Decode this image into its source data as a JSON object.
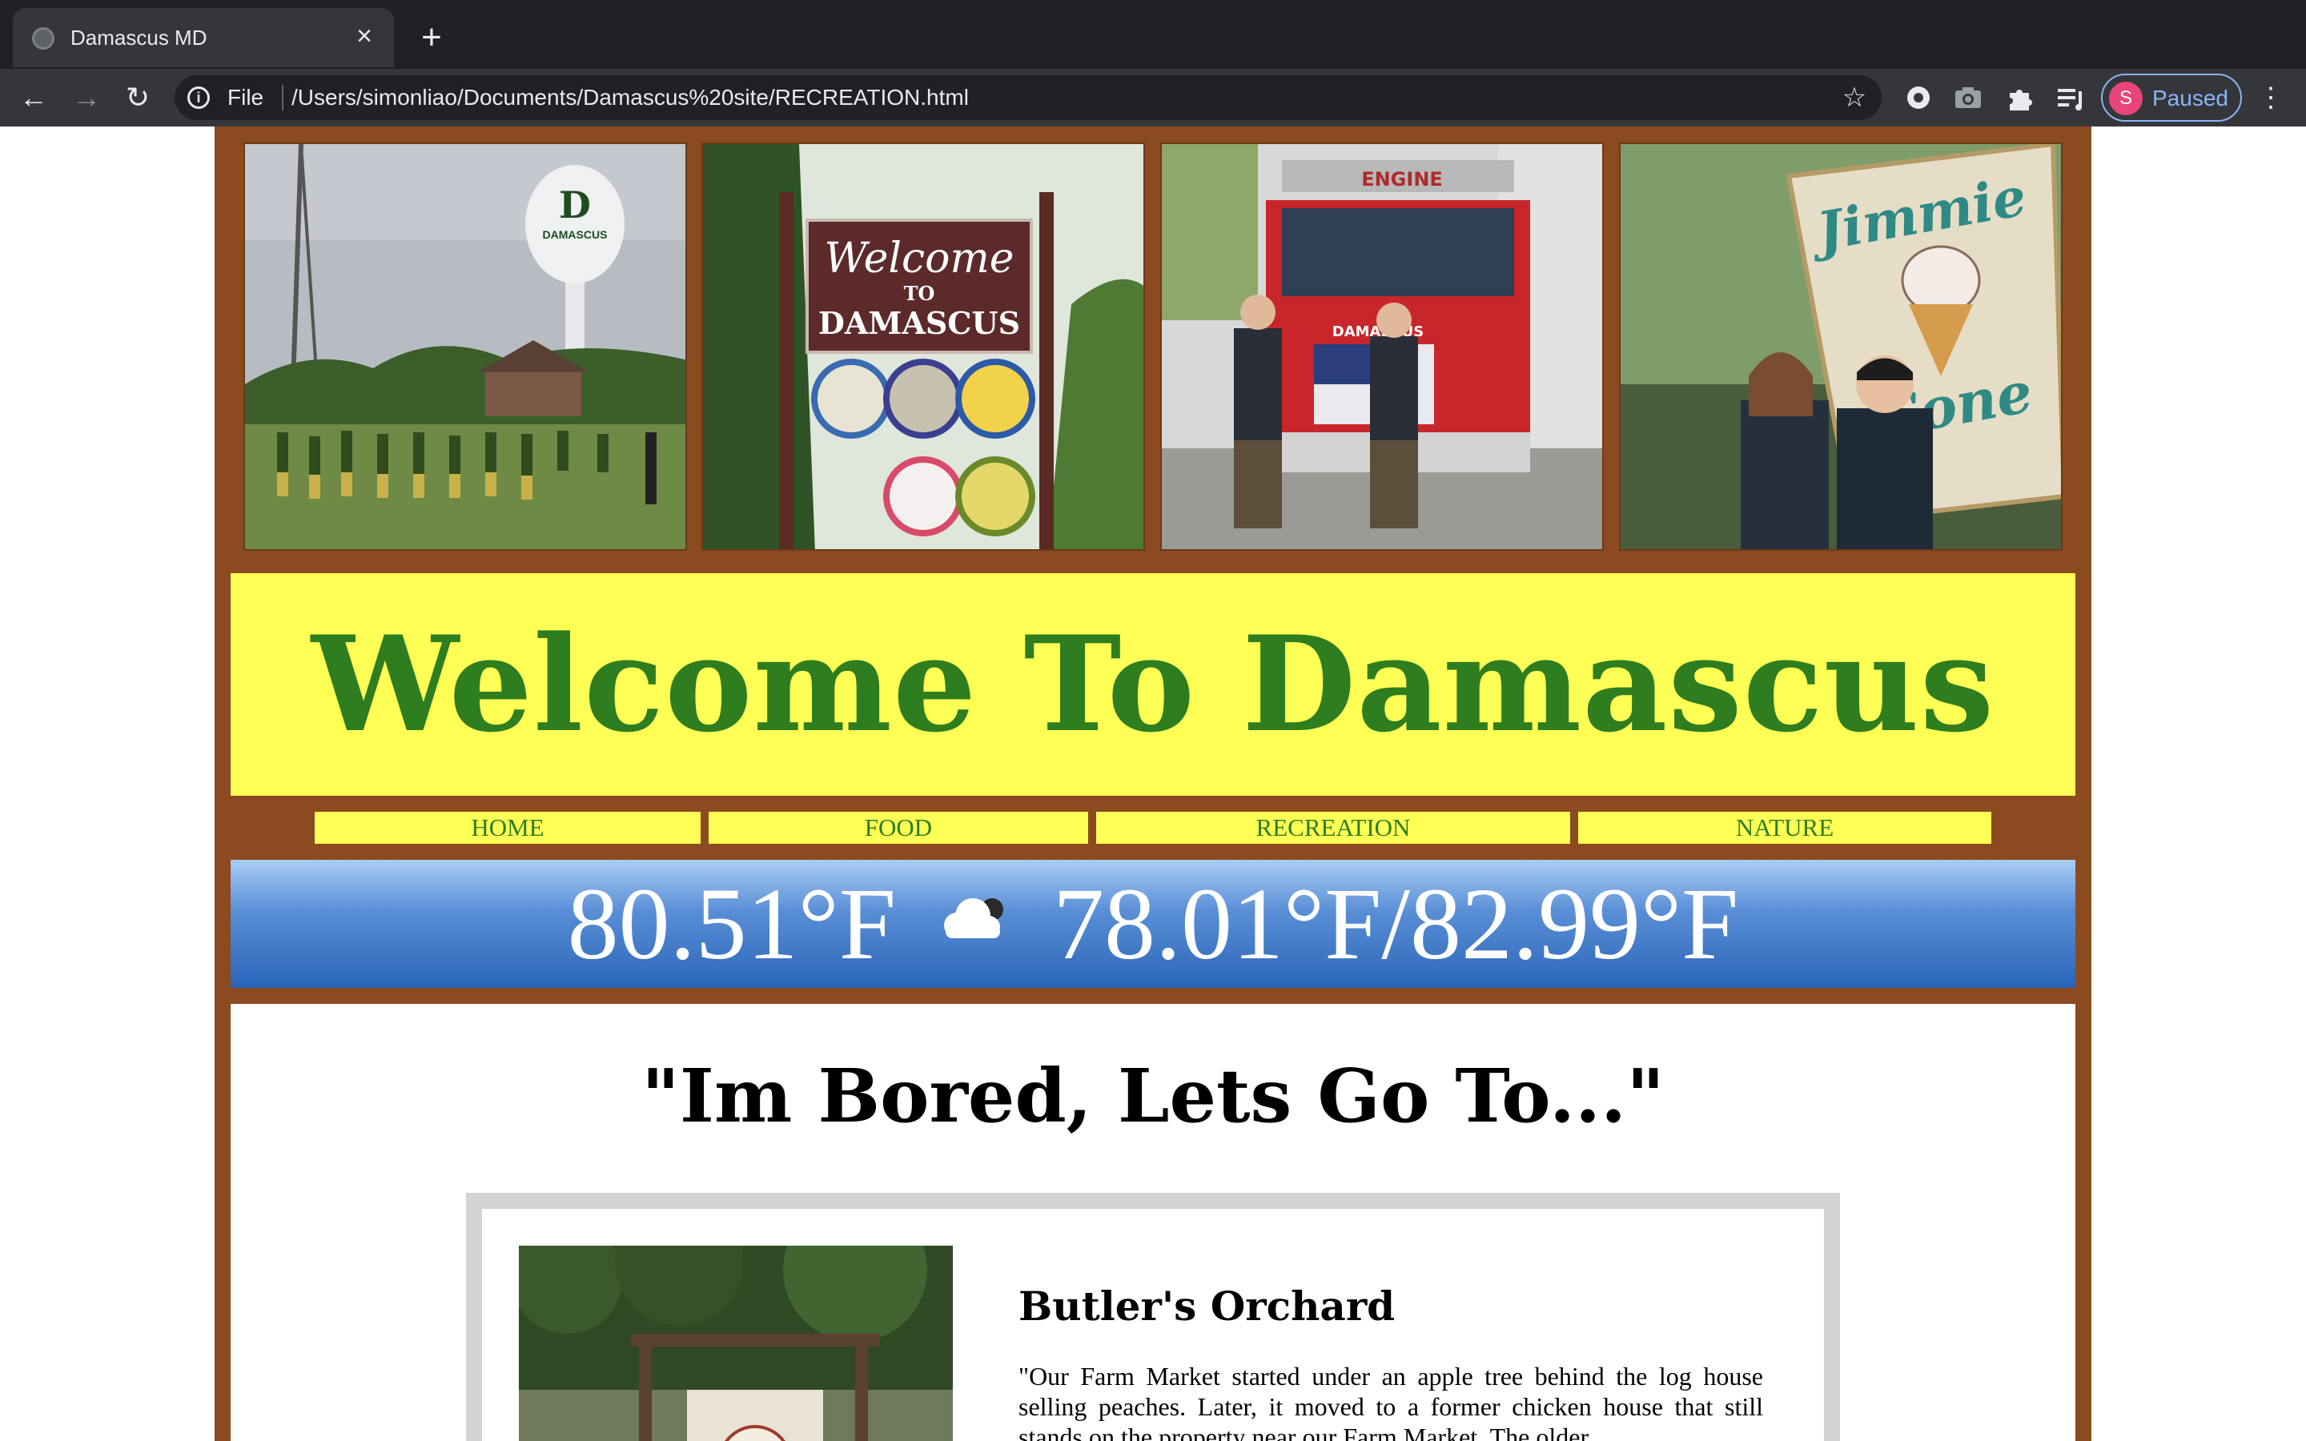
{
  "browser": {
    "tab_title": "Damascus MD",
    "url_scheme": "File",
    "url": "/Users/simonliao/Documents/Damascus%20site/RECREATION.html",
    "profile_initial": "S",
    "profile_status": "Paused",
    "icons": {
      "back": "back-arrow-icon",
      "forward": "forward-arrow-icon",
      "reload": "reload-icon",
      "info": "info-icon",
      "bookmark": "star-icon",
      "extensions": [
        "extension-round-icon",
        "camera-icon",
        "puzzle-icon",
        "reading-list-icon"
      ],
      "menu": "kebab-menu-icon"
    }
  },
  "header": {
    "photos": [
      {
        "name": "water-tower-football-photo",
        "caption": "DAMASCUS"
      },
      {
        "name": "welcome-sign-photo",
        "line1": "Welcome",
        "line2": "TO",
        "line3": "DAMASCUS"
      },
      {
        "name": "fire-engine-photo",
        "caption": "ENGINE",
        "truck_label": "DAMASCUS"
      },
      {
        "name": "jimmie-cone-photo",
        "line1": "Jimmie",
        "line2": "Cone"
      }
    ],
    "title": "Welcome To Damascus"
  },
  "nav": {
    "items": [
      "HOME",
      "FOOD",
      "RECREATION",
      "NATURE"
    ]
  },
  "weather": {
    "current": "80.51°F",
    "icon": "cloud-icon",
    "range": "78.01°F/82.99°F"
  },
  "main": {
    "heading": "\"Im Bored, Lets Go To...\"",
    "cards": [
      {
        "title": "Butler's Orchard",
        "description": "\"Our Farm Market started under an apple tree behind the log house selling peaches. Later, it moved to a former chicken house that still stands on the property near our Farm Market. The older",
        "image": "butlers-orchard-photo"
      }
    ]
  },
  "colors": {
    "frame": "#8b4a20",
    "banner": "#ffff55",
    "title_green": "#2e7d1e",
    "weather_top": "#a9ccf5",
    "weather_bottom": "#2a65b8"
  }
}
